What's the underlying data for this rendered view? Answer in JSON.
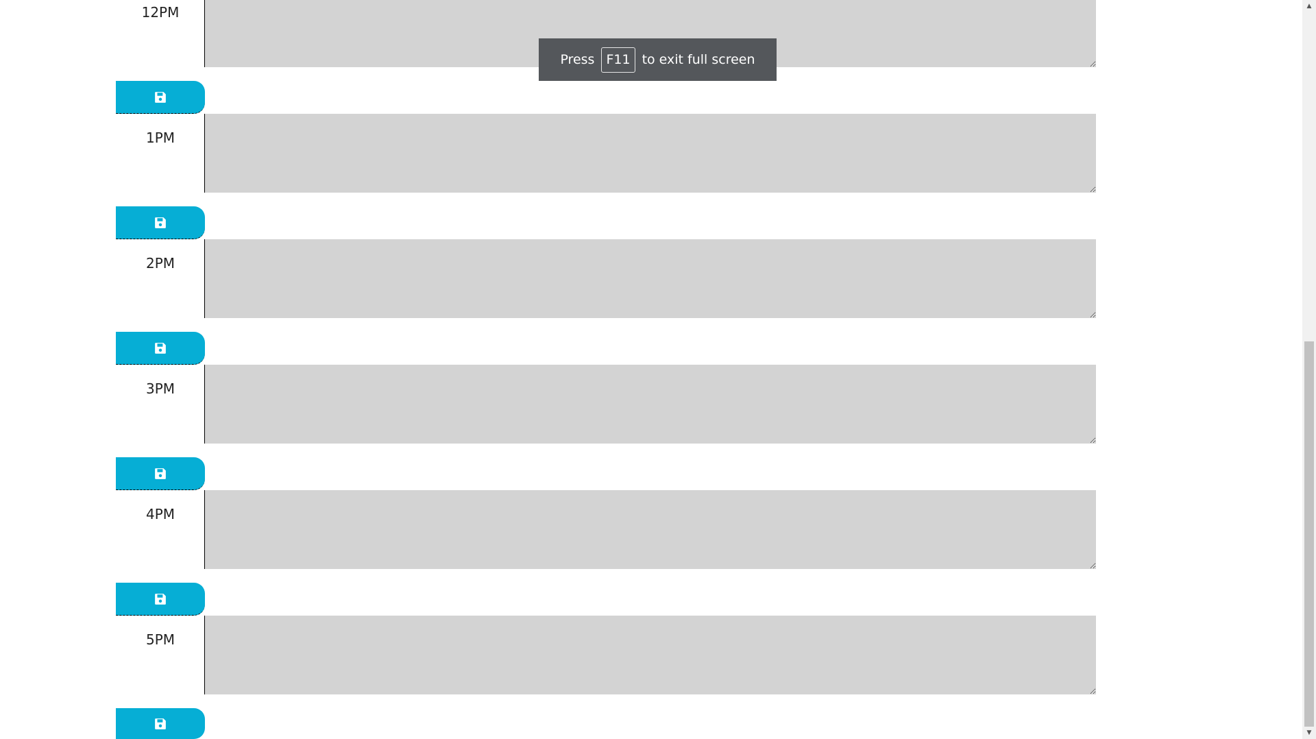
{
  "planner": {
    "hours": [
      {
        "label": "12PM",
        "text": ""
      },
      {
        "label": "1PM",
        "text": ""
      },
      {
        "label": "2PM",
        "text": ""
      },
      {
        "label": "3PM",
        "text": ""
      },
      {
        "label": "4PM",
        "text": ""
      },
      {
        "label": "5PM",
        "text": ""
      }
    ],
    "save_icon": "save-icon"
  },
  "fullscreen_toast": {
    "prefix": "Press",
    "key": "F11",
    "suffix": "to exit full screen"
  },
  "colors": {
    "save_button": "#06aed5",
    "textarea": "#d3d3d3",
    "toast_background": "#54575b"
  }
}
